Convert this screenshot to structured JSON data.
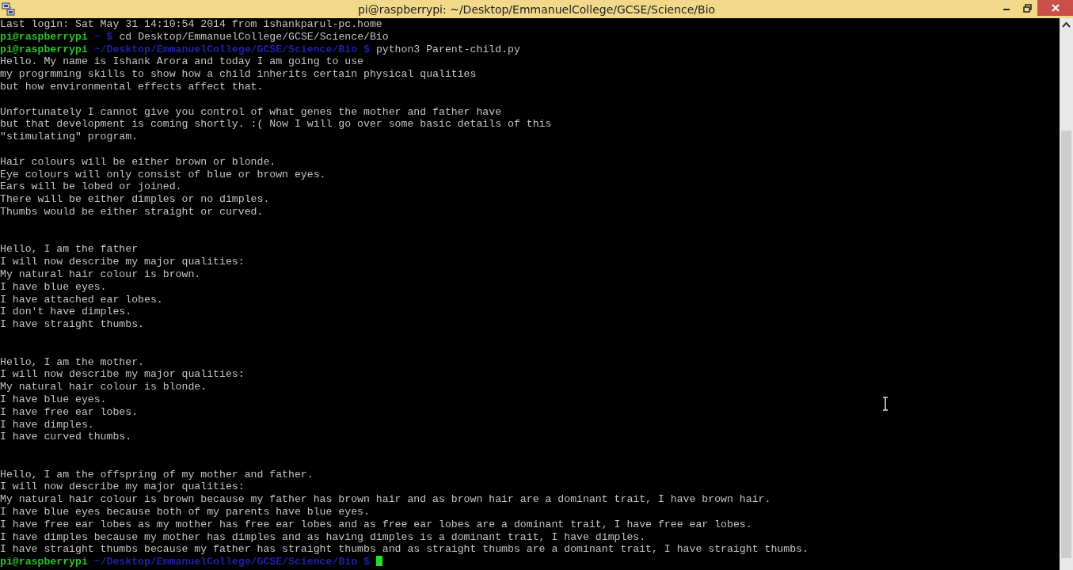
{
  "window": {
    "title": "pi@raspberrypi: ~/Desktop/EmmanuelCollege/GCSE/Science/Bio"
  },
  "terminal": {
    "lines": [
      {
        "kind": "output",
        "text": "Last login: Sat May 31 14:10:54 2014 from ishankparul-pc.home"
      },
      {
        "kind": "prompt",
        "user": "pi@raspberrypi",
        "path": "~",
        "symbol": "$",
        "command": "cd Desktop/EmmanuelCollege/GCSE/Science/Bio"
      },
      {
        "kind": "prompt",
        "user": "pi@raspberrypi",
        "path": "~/Desktop/EmmanuelCollege/GCSE/Science/Bio",
        "symbol": "$",
        "command": "python3 Parent-child.py"
      },
      {
        "kind": "output",
        "text": "Hello. My name is Ishank Arora and today I am going to use"
      },
      {
        "kind": "output",
        "text": "my progrmming skills to show how a child inherits certain physical qualities"
      },
      {
        "kind": "output",
        "text": "but how environmental effects affect that."
      },
      {
        "kind": "blank"
      },
      {
        "kind": "output",
        "text": "Unfortunately I cannot give you control of what genes the mother and father have"
      },
      {
        "kind": "output",
        "text": "but that development is coming shortly. :( Now I will go over some basic details of this"
      },
      {
        "kind": "output",
        "text": "\"stimulating\" program."
      },
      {
        "kind": "blank"
      },
      {
        "kind": "output",
        "text": "Hair colours will be either brown or blonde."
      },
      {
        "kind": "output",
        "text": "Eye colours will only consist of blue or brown eyes."
      },
      {
        "kind": "output",
        "text": "Ears will be lobed or joined."
      },
      {
        "kind": "output",
        "text": "There will be either dimples or no dimples."
      },
      {
        "kind": "output",
        "text": "Thumbs would be either straight or curved."
      },
      {
        "kind": "blank"
      },
      {
        "kind": "blank"
      },
      {
        "kind": "output",
        "text": "Hello, I am the father"
      },
      {
        "kind": "output",
        "text": "I will now describe my major qualities:"
      },
      {
        "kind": "output",
        "text": "My natural hair colour is brown."
      },
      {
        "kind": "output",
        "text": "I have blue eyes."
      },
      {
        "kind": "output",
        "text": "I have attached ear lobes."
      },
      {
        "kind": "output",
        "text": "I don't have dimples."
      },
      {
        "kind": "output",
        "text": "I have straight thumbs."
      },
      {
        "kind": "blank"
      },
      {
        "kind": "blank"
      },
      {
        "kind": "output",
        "text": "Hello, I am the mother."
      },
      {
        "kind": "output",
        "text": "I will now describe my major qualities:"
      },
      {
        "kind": "output",
        "text": "My natural hair colour is blonde."
      },
      {
        "kind": "output",
        "text": "I have blue eyes."
      },
      {
        "kind": "output",
        "text": "I have free ear lobes."
      },
      {
        "kind": "output",
        "text": "I have dimples."
      },
      {
        "kind": "output",
        "text": "I have curved thumbs."
      },
      {
        "kind": "blank"
      },
      {
        "kind": "blank"
      },
      {
        "kind": "output",
        "text": "Hello, I am the offspring of my mother and father."
      },
      {
        "kind": "output",
        "text": "I will now describe my major qualities:"
      },
      {
        "kind": "output",
        "text": "My natural hair colour is brown because my father has brown hair and as brown hair are a dominant trait, I have brown hair."
      },
      {
        "kind": "output",
        "text": "I have blue eyes because both of my parents have blue eyes."
      },
      {
        "kind": "output",
        "text": "I have free ear lobes as my mother has free ear lobes and as free ear lobes are a dominant trait, I have free ear lobes."
      },
      {
        "kind": "output",
        "text": "I have dimples because my mother has dimples and as having dimples is a dominant trait, I have dimples."
      },
      {
        "kind": "output",
        "text": "I have straight thumbs because my father has straight thumbs and as straight thumbs are a dominant trait, I have straight thumbs."
      },
      {
        "kind": "prompt",
        "user": "pi@raspberrypi",
        "path": "~/Desktop/EmmanuelCollege/GCSE/Science/Bio",
        "symbol": "$",
        "cursor": true
      }
    ]
  }
}
